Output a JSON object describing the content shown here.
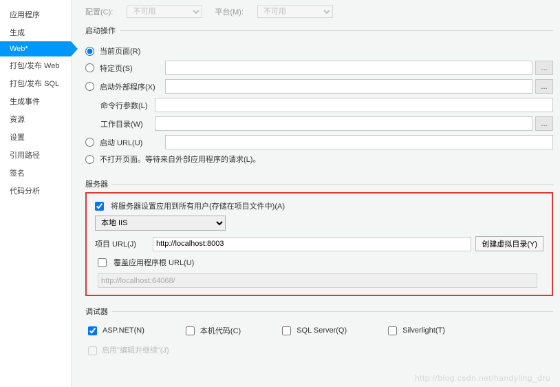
{
  "sidebar": {
    "items": [
      {
        "label": "应用程序"
      },
      {
        "label": "生成"
      },
      {
        "label": "Web*",
        "active": true
      },
      {
        "label": "打包/发布 Web"
      },
      {
        "label": "打包/发布 SQL"
      },
      {
        "label": "生成事件"
      },
      {
        "label": "资源"
      },
      {
        "label": "设置"
      },
      {
        "label": "引用路径"
      },
      {
        "label": "签名"
      },
      {
        "label": "代码分析"
      }
    ]
  },
  "top": {
    "config_label": "配置(C):",
    "config_value": "不可用",
    "platform_label": "平台(M):",
    "platform_value": "不可用"
  },
  "start": {
    "legend": "启动操作",
    "current_page": "当前页面(R)",
    "specific_page": "特定页(S)",
    "external_program": "启动外部程序(X)",
    "cmdline_args": "命令行参数(L)",
    "working_dir": "工作目录(W)",
    "start_url": "启动 URL(U)",
    "dont_open": "不打开页面。等待来自外部应用程序的请求(L)。",
    "browse": "..."
  },
  "server": {
    "legend": "服务器",
    "apply_all": "将服务器设置应用到所有用户(存储在项目文件中)(A)",
    "select_value": "本地 IIS",
    "project_url_label": "项目 URL(J)",
    "project_url_value": "http://localhost:8003",
    "create_vdir": "创建虚拟目录(Y)",
    "override_root": "覆盖应用程序根 URL(U)",
    "override_value": "http://localhost:64068/"
  },
  "debugger": {
    "legend": "调试器",
    "aspnet": "ASP.NET(N)",
    "native": "本机代码(C)",
    "sqlserver": "SQL Server(Q)",
    "silverlight": "Silverlight(T)",
    "edit_continue": "启用\"编辑并继续\"(J)"
  },
  "watermark": "http://blog.csdn.net/handyling_dru"
}
